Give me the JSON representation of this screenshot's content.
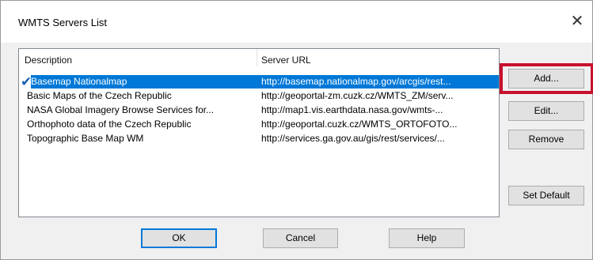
{
  "window": {
    "title": "WMTS Servers List",
    "close_glyph": "✕"
  },
  "list": {
    "columns": [
      "Description",
      "Server URL"
    ],
    "rows": [
      {
        "description": "Basemap Nationalmap",
        "url": "http://basemap.nationalmap.gov/arcgis/rest...",
        "selected": true,
        "checked": true
      },
      {
        "description": "Basic Maps of the Czech Republic",
        "url": "http://geoportal-zm.cuzk.cz/WMTS_ZM/serv...",
        "selected": false,
        "checked": false
      },
      {
        "description": "NASA Global Imagery Browse Services for...",
        "url": "http://map1.vis.earthdata.nasa.gov/wmts-...",
        "selected": false,
        "checked": false
      },
      {
        "description": "Orthophoto data of the Czech Republic",
        "url": "http://geoportal.cuzk.cz/WMTS_ORTOFOTO...",
        "selected": false,
        "checked": false
      },
      {
        "description": "Topographic Base Map WM",
        "url": "http://services.ga.gov.au/gis/rest/services/...",
        "selected": false,
        "checked": false
      }
    ],
    "check_glyph": "✔"
  },
  "buttons": {
    "add": "Add...",
    "edit": "Edit...",
    "remove": "Remove",
    "set_default": "Set Default",
    "ok": "OK",
    "cancel": "Cancel",
    "help": "Help"
  },
  "colors": {
    "selection": "#0078d7",
    "highlight_box": "#c8102e",
    "check": "#1a5fb4"
  }
}
